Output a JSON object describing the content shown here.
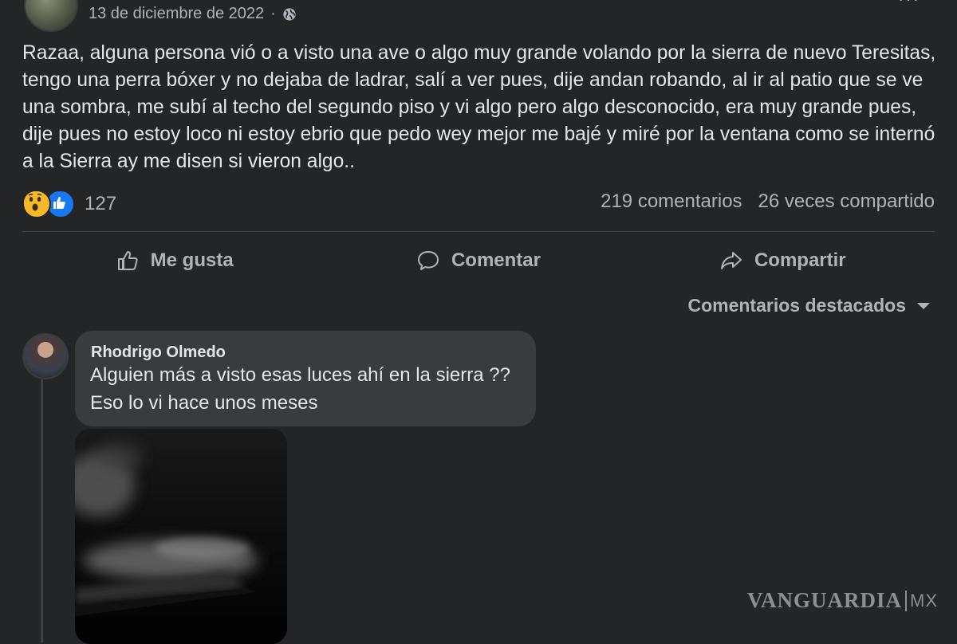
{
  "post": {
    "date": "13 de diciembre de 2022",
    "dot": "·",
    "privacy_icon": "globe-icon",
    "text": "Razaa, alguna persona vió o a visto una ave o algo muy grande volando por la sierra de nuevo Teresitas, tengo una perra bóxer y no dejaba de ladrar, salí a ver pues, dije andan robando, al ir al patio que se ve una sombra, me subí al techo del segundo piso y vi algo pero algo desconocido, era muy grande pues, dije pues  no estoy loco ni estoy ebrio que pedo wey mejor me bajé y miré por la ventana como se internó a la Sierra ay me disen si vieron algo..",
    "reactions": {
      "icons": [
        "wow-reaction-icon",
        "like-reaction-icon"
      ],
      "count": "127"
    },
    "comments_count": "219 comentarios",
    "shares_count": "26 veces compartido"
  },
  "actions": {
    "like_label": "Me gusta",
    "comment_label": "Comentar",
    "share_label": "Compartir"
  },
  "sort": {
    "label": "Comentarios destacados"
  },
  "comment": {
    "author": "Rhodrigo Olmedo",
    "line1": "Alguien más a visto esas luces ahí en la sierra ??",
    "line2": "Eso lo vi hace unos meses"
  },
  "watermark": {
    "brand": "VANGUARDIA",
    "suffix": "MX"
  },
  "colors": {
    "background": "#242526",
    "bubble": "#3a3b3c",
    "text": "#e4e6eb",
    "muted": "#b0b3b8",
    "like_blue": "#1877f2",
    "wow_yellow": "#f7b928"
  }
}
